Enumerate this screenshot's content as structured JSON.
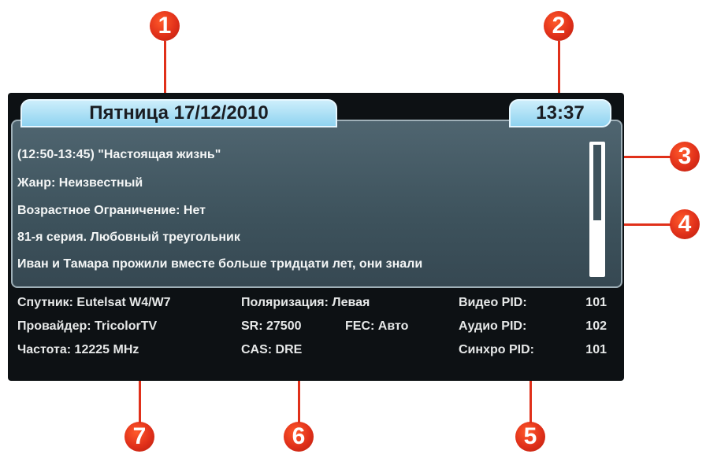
{
  "header": {
    "date": "Пятница 17/12/2010",
    "time": "13:37"
  },
  "program": {
    "lines": [
      "(12:50-13:45) \"Настоящая жизнь\"",
      "Жанр: Неизвестный",
      "Возрастное Ограничение: Нет",
      "81-я серия. Любовный треугольник",
      "Иван и Тамара прожили вместе больше тридцати лет, они знали"
    ]
  },
  "tech": {
    "satellite": "Спутник: Eutelsat W4/W7",
    "provider": "Провайдер: TricolorTV",
    "frequency": "Частота: 12225 MHz",
    "polarization": "Поляризация: Левая",
    "sr": "SR: 27500",
    "fec": "FEC: Авто",
    "cas": "CAS: DRE",
    "video_pid_label": "Видео PID:",
    "audio_pid_label": "Аудио PID:",
    "sync_pid_label": "Синхро PID:",
    "video_pid": "101",
    "audio_pid": "102",
    "sync_pid": "101"
  },
  "callouts": [
    "1",
    "2",
    "3",
    "4",
    "5",
    "6",
    "7"
  ],
  "colors": {
    "marker": "#e0301a",
    "tab": "#8fd3f0",
    "panel": "#3d525c",
    "frame": "#0d1114"
  }
}
